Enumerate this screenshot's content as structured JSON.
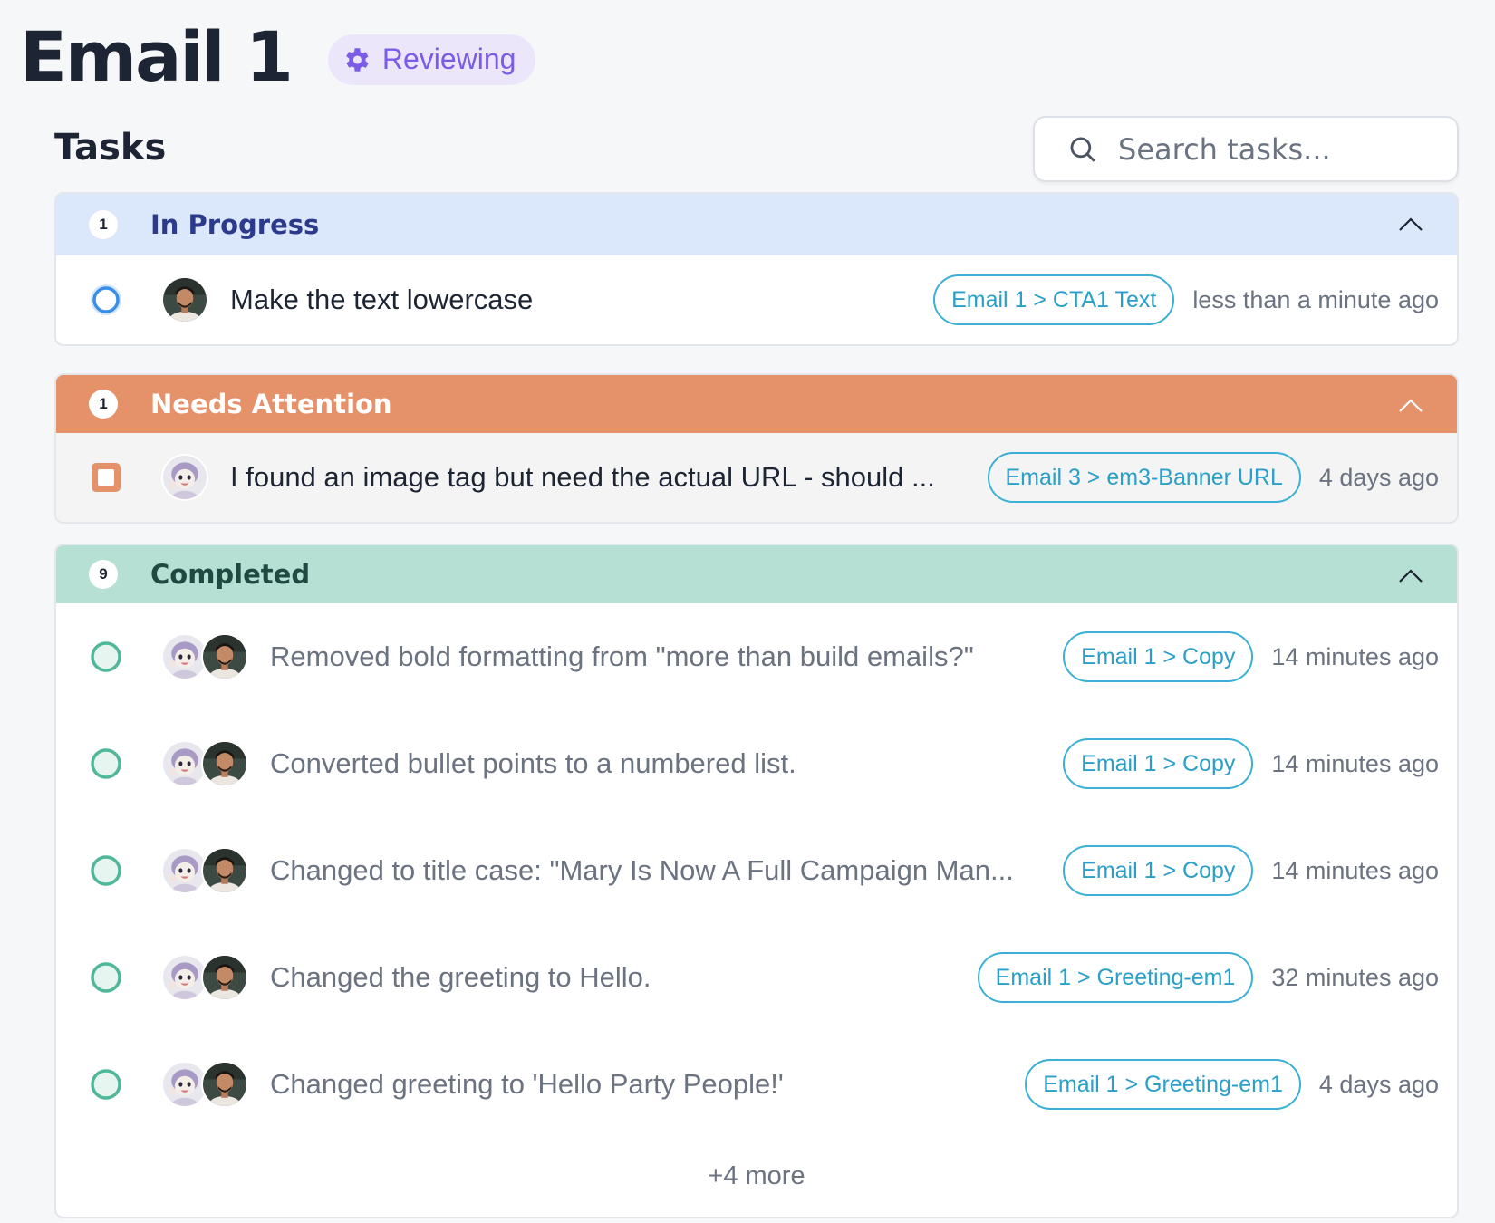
{
  "header": {
    "title": "Email 1",
    "status_label": "Reviewing",
    "status_icon": "gear-icon"
  },
  "tasks_title": "Tasks",
  "search": {
    "placeholder": "Search tasks...",
    "value": ""
  },
  "colors": {
    "in_progress_bg": "#dbe7fb",
    "in_progress_text": "#2c3a8c",
    "needs_attention_bg": "#e5916a",
    "completed_bg": "#b5e0d3",
    "completed_text": "#1e4a42",
    "tag": "#2a9fc9",
    "completed_dot": "#4fb89a"
  },
  "groups": {
    "in_progress": {
      "label": "In Progress",
      "count": "1",
      "tasks": [
        {
          "text": "Make the text lowercase",
          "tag": "Email 1 > CTA1 Text",
          "time": "less than a minute ago",
          "status": "in-progress",
          "avatars": [
            "man-avatar"
          ]
        }
      ]
    },
    "needs_attention": {
      "label": "Needs Attention",
      "count": "1",
      "tasks": [
        {
          "text": "I found an image tag but need the actual URL - should ...",
          "tag": "Email 3 > em3-Banner URL",
          "time": "4 days ago",
          "status": "needs-attention",
          "avatars": [
            "robot-avatar"
          ]
        }
      ]
    },
    "completed": {
      "label": "Completed",
      "count": "9",
      "more": "+4 more",
      "tasks": [
        {
          "text": "Removed bold formatting from \"more than build emails?\"",
          "tag": "Email 1 > Copy",
          "time": "14 minutes ago",
          "status": "completed",
          "avatars": [
            "robot-avatar",
            "man-avatar"
          ]
        },
        {
          "text": "Converted bullet points to a numbered list.",
          "tag": "Email 1 > Copy",
          "time": "14 minutes ago",
          "status": "completed",
          "avatars": [
            "robot-avatar",
            "man-avatar"
          ]
        },
        {
          "text": "Changed to title case: \"Mary Is Now A Full Campaign Man...",
          "tag": "Email 1 > Copy",
          "time": "14 minutes ago",
          "status": "completed",
          "avatars": [
            "robot-avatar",
            "man-avatar"
          ]
        },
        {
          "text": "Changed the greeting to Hello.",
          "tag": "Email 1 > Greeting-em1",
          "time": "32 minutes ago",
          "status": "completed",
          "avatars": [
            "robot-avatar",
            "man-avatar"
          ]
        },
        {
          "text": "Changed greeting to 'Hello Party People!'",
          "tag": "Email 1 > Greeting-em1",
          "time": "4 days ago",
          "status": "completed",
          "avatars": [
            "robot-avatar",
            "man-avatar"
          ]
        }
      ]
    }
  }
}
